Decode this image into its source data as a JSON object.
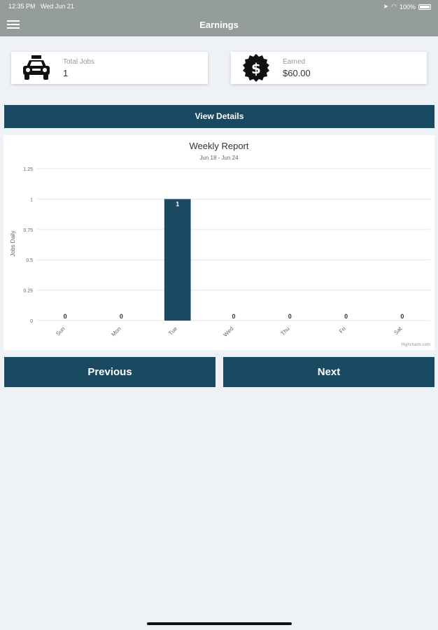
{
  "status_bar": {
    "time": "12:35 PM",
    "date": "Wed Jun 21",
    "battery": "100%"
  },
  "nav": {
    "title": "Earnings"
  },
  "stats": {
    "total_jobs_label": "Total Jobs",
    "total_jobs_value": "1",
    "earned_label": "Earned",
    "earned_value": "$60.00"
  },
  "buttons": {
    "view_details": "View Details",
    "previous": "Previous",
    "next": "Next"
  },
  "colors": {
    "bar": "#1a4a62",
    "header": "#949c9c",
    "background": "#eef1f6"
  },
  "icons": {
    "menu": "hamburger-icon",
    "jobs": "taxi-icon",
    "earned": "dollar-badge-icon"
  },
  "chart_data": {
    "type": "bar",
    "title": "Weekly Report",
    "subtitle": "Jun 18 - Jun 24",
    "ylabel": "Jobs Daily",
    "xlabel": "",
    "categories": [
      "Sun",
      "Mon",
      "Tue",
      "Wed",
      "Thu",
      "Fri",
      "Sat"
    ],
    "values": [
      0,
      0,
      1,
      0,
      0,
      0,
      0
    ],
    "data_labels": [
      "0",
      "0",
      "1",
      "0",
      "0",
      "0",
      "0"
    ],
    "ylim": [
      0,
      1.25
    ],
    "yticks": [
      "0",
      "0.25",
      "0.5",
      "0.75",
      "1",
      "1.25"
    ],
    "ytick_values": [
      0,
      0.25,
      0.5,
      0.75,
      1,
      1.25
    ],
    "grid": true,
    "credits": "Highcharts.com"
  }
}
